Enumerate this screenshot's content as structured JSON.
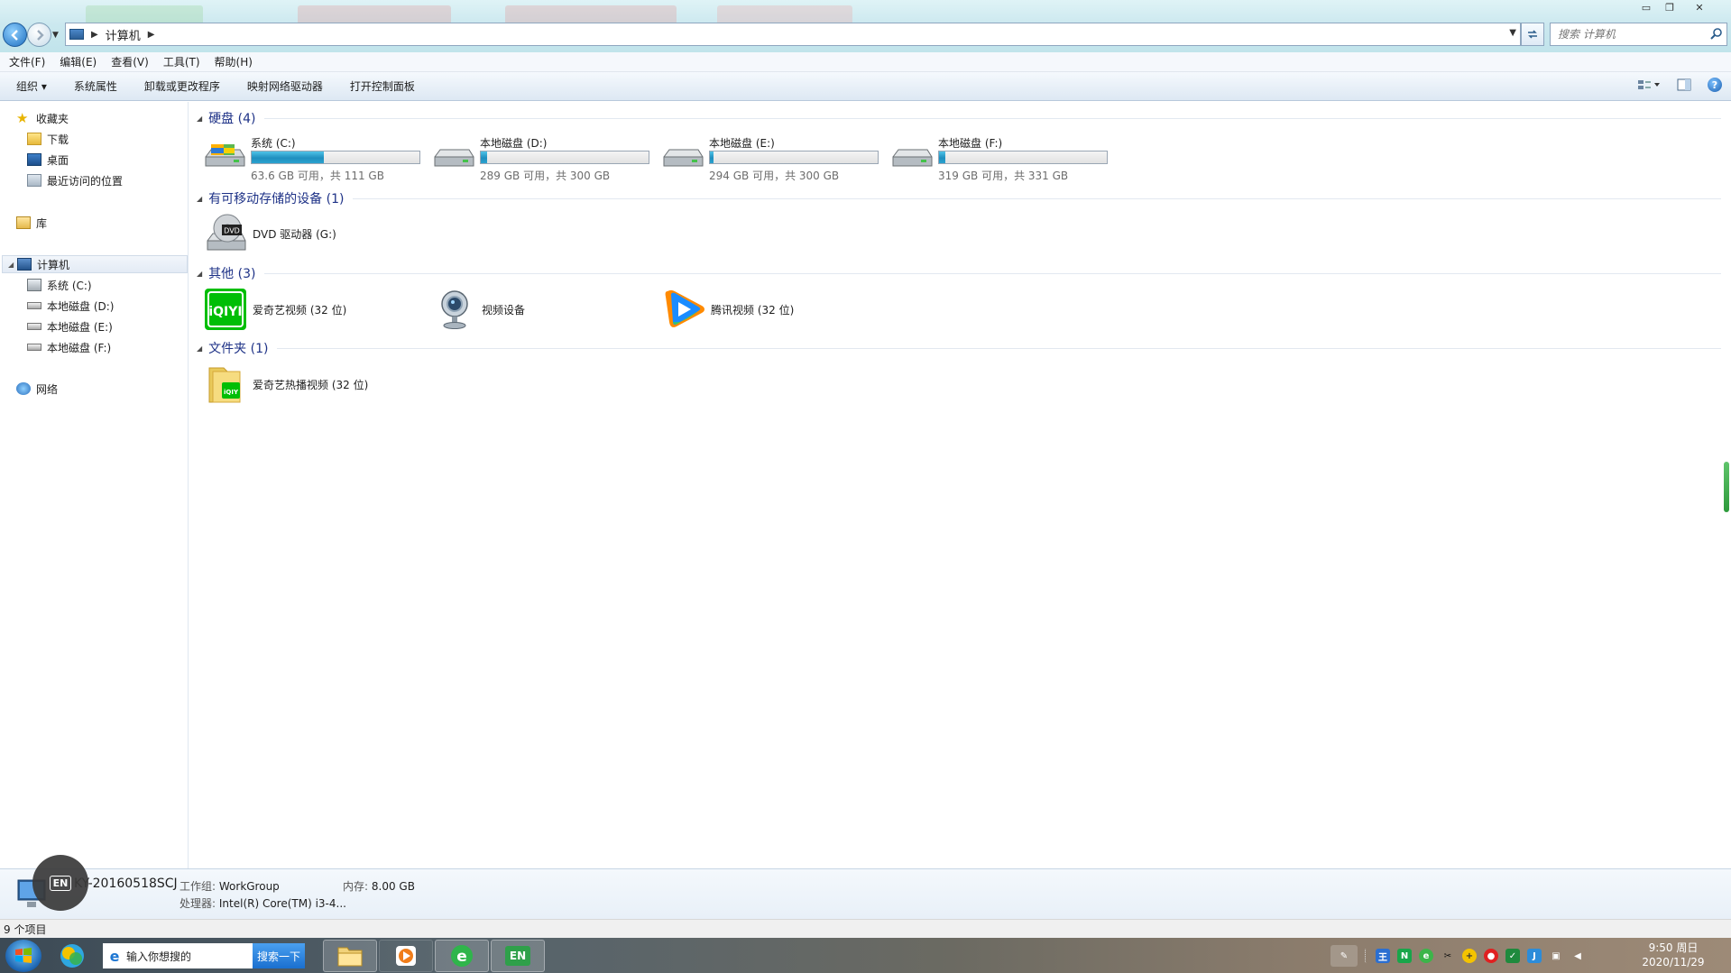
{
  "window": {
    "search_placeholder": "搜索 计算机",
    "breadcrumb": [
      "计算机"
    ],
    "controls": {
      "minimize": "▭",
      "maximize": "❐",
      "close": "✕"
    }
  },
  "menu": {
    "items": [
      "文件(F)",
      "编辑(E)",
      "查看(V)",
      "工具(T)",
      "帮助(H)"
    ]
  },
  "toolbar": {
    "organize": "组织 ▾",
    "commands": [
      "系统属性",
      "卸载或更改程序",
      "映射网络驱动器",
      "打开控制面板"
    ],
    "help": "?"
  },
  "nav": {
    "favorites": "收藏夹",
    "favorites_items": [
      "下载",
      "桌面",
      "最近访问的位置"
    ],
    "libraries": "库",
    "computer": "计算机",
    "computer_items": [
      "系统 (C:)",
      "本地磁盘 (D:)",
      "本地磁盘 (E:)",
      "本地磁盘 (F:)"
    ],
    "network": "网络"
  },
  "groups": {
    "hard_disks": "硬盘 (4)",
    "removable": "有可移动存储的设备 (1)",
    "other": "其他 (3)",
    "folders": "文件夹 (1)"
  },
  "drives": [
    {
      "name": "系统 (C:)",
      "free": "63.6 GB 可用，共 111 GB",
      "used_fraction": 0.43
    },
    {
      "name": "本地磁盘 (D:)",
      "free": "289 GB 可用，共 300 GB",
      "used_fraction": 0.04
    },
    {
      "name": "本地磁盘 (E:)",
      "free": "294 GB 可用，共 300 GB",
      "used_fraction": 0.02
    },
    {
      "name": "本地磁盘 (F:)",
      "free": "319 GB 可用，共 331 GB",
      "used_fraction": 0.04
    }
  ],
  "removable": [
    {
      "name": "DVD 驱动器 (G:)",
      "icon": "dvd-drive-icon"
    }
  ],
  "other": [
    {
      "name": "爱奇艺视频 (32 位)",
      "icon": "iqiyi-icon"
    },
    {
      "name": "视频设备",
      "icon": "webcam-icon"
    },
    {
      "name": "腾讯视频 (32 位)",
      "icon": "tencent-video-icon"
    }
  ],
  "folders": [
    {
      "name": "爱奇艺热播视频 (32 位)",
      "icon": "folder-iqiyi-icon"
    }
  ],
  "details": {
    "pc_name": "KY-20160518SCJ",
    "workgroup_label": "工作组:",
    "workgroup": "WorkGroup",
    "memory_label": "内存:",
    "memory": "8.00 GB",
    "cpu_label": "处理器:",
    "cpu": "Intel(R) Core(TM) i3-4..."
  },
  "ime_badge": "EN",
  "status": {
    "item_count": "9 个项目"
  },
  "taskbar": {
    "search_placeholder": "输入你想搜的",
    "search_button": "搜索一下",
    "ime": "EN",
    "time": "9:50 周日",
    "date": "2020/11/29"
  },
  "colors": {
    "group_header": "#1e3287",
    "drive_fill": "#1f8fbf",
    "iqiyi_green": "#00be06",
    "tencent_blue": "#1a8cff"
  }
}
